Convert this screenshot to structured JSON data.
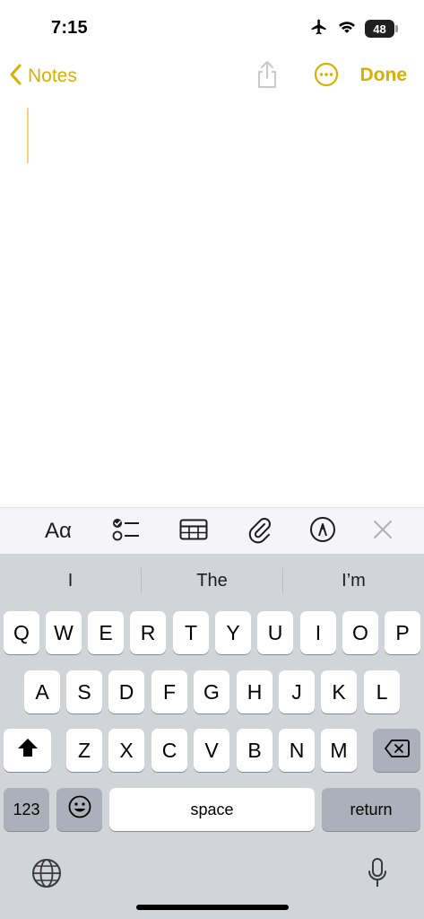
{
  "status": {
    "time": "7:15",
    "battery": "48"
  },
  "nav": {
    "back_label": "Notes",
    "done_label": "Done"
  },
  "format_toolbar": {
    "text_style_label": "Aα"
  },
  "suggestions": [
    "I",
    "The",
    "I’m"
  ],
  "keyboard": {
    "row1": [
      "Q",
      "W",
      "E",
      "R",
      "T",
      "Y",
      "U",
      "I",
      "O",
      "P"
    ],
    "row2": [
      "A",
      "S",
      "D",
      "F",
      "G",
      "H",
      "J",
      "K",
      "L"
    ],
    "row3": [
      "Z",
      "X",
      "C",
      "V",
      "B",
      "N",
      "M"
    ],
    "numbers_label": "123",
    "space_label": "space",
    "return_label": "return"
  },
  "colors": {
    "accent": "#d9b000",
    "keyboard_bg": "#d1d4d9",
    "special_key": "#abb0ba"
  },
  "icons": [
    "airplane-icon",
    "wifi-icon",
    "battery-icon",
    "chevron-left-icon",
    "share-icon",
    "more-icon",
    "checklist-icon",
    "table-icon",
    "paperclip-icon",
    "markup-icon",
    "close-icon",
    "shift-icon",
    "backspace-icon",
    "emoji-icon",
    "globe-icon",
    "microphone-icon"
  ]
}
